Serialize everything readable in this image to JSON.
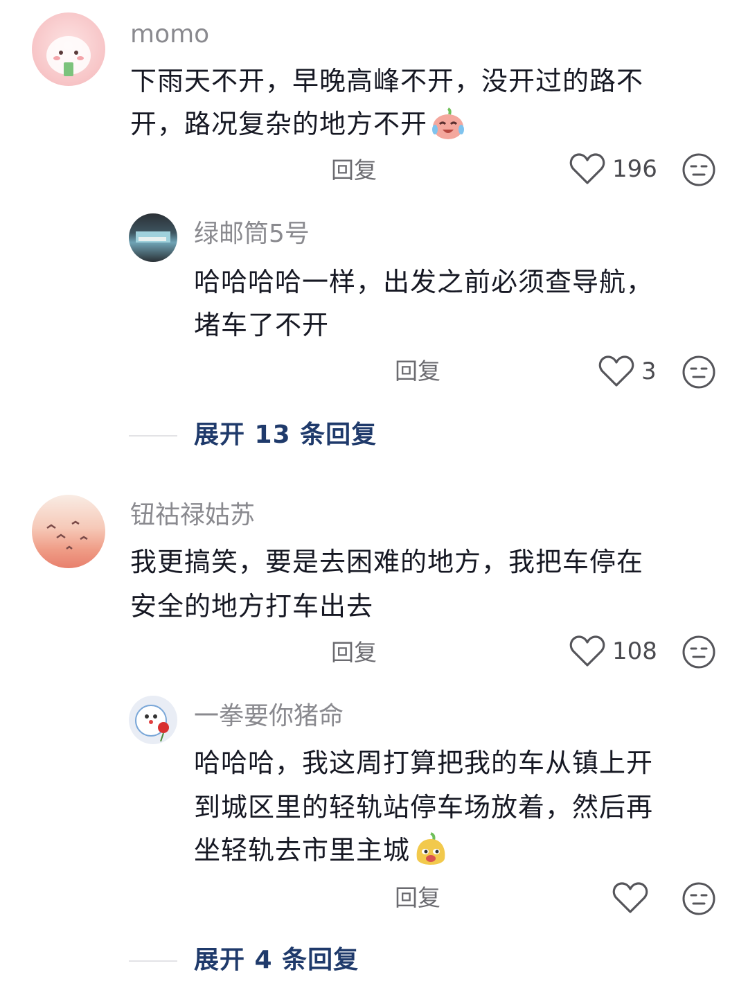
{
  "comments": [
    {
      "username": "momo",
      "text_lines": [
        "下雨天不开，早晚高峰不开，没开过的路不",
        "开，路况复杂的地方不开"
      ],
      "reply_label": "回复",
      "likes": "196",
      "reply": {
        "username": "绿邮筒5号",
        "text_lines": [
          "哈哈哈哈一样，出发之前必须查导航，",
          "堵车了不开"
        ],
        "reply_label": "回复",
        "likes": "3"
      },
      "expand_label": "展开 13 条回复"
    },
    {
      "username": "钮祜禄姑苏",
      "text_lines": [
        "我更搞笑，要是去困难的地方，我把车停在",
        "安全的地方打车出去"
      ],
      "reply_label": "回复",
      "likes": "108",
      "reply": {
        "username": "一拳要你猪命",
        "text_lines": [
          "哈哈哈，我这周打算把我的车从镇上开",
          "到城区里的轻轨站停车场放着，然后再",
          "坐轻轨去市里主城"
        ],
        "reply_label": "回复",
        "likes": ""
      },
      "expand_label": "展开 4 条回复"
    }
  ],
  "icons": {
    "like": "heart-outline-icon",
    "dislike": "neutral-face-icon",
    "emoji_crying": "crying-laughing-emoji-icon",
    "emoji_smirk": "smirk-emoji-icon"
  },
  "colors": {
    "expand_link": "#1f3a6b",
    "username": "#8a8a8f",
    "body_text": "#161823"
  }
}
